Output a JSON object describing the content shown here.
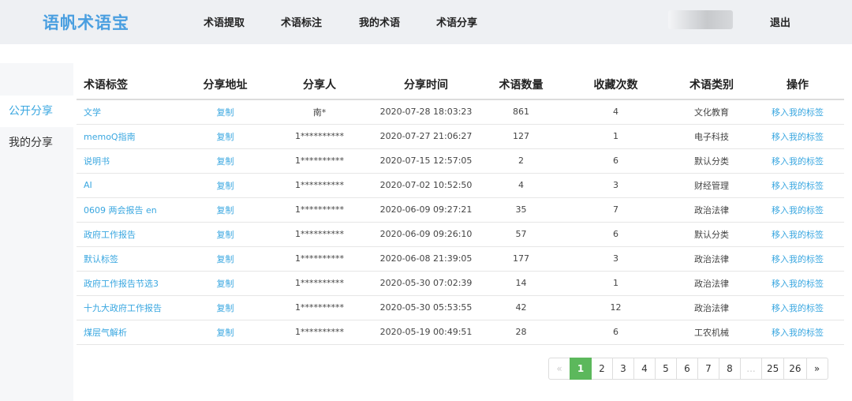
{
  "header": {
    "logo": "语帆术语宝",
    "nav": [
      "术语提取",
      "术语标注",
      "我的术语",
      "术语分享"
    ],
    "logout": "退出"
  },
  "sidebar": {
    "items": [
      {
        "label": "公开分享",
        "active": true
      },
      {
        "label": "我的分享",
        "active": false
      }
    ]
  },
  "table": {
    "headers": [
      "术语标签",
      "分享地址",
      "分享人",
      "分享时间",
      "术语数量",
      "收藏次数",
      "术语类别",
      "操作"
    ],
    "rows": [
      {
        "tag": "文学",
        "addr": "复制",
        "user": "南*",
        "time": "2020-07-28 18:03:23",
        "count": "861",
        "fav": "4",
        "cat": "文化教育",
        "op": "移入我的标签"
      },
      {
        "tag": "memoQ指南",
        "addr": "复制",
        "user": "1**********",
        "time": "2020-07-27 21:06:27",
        "count": "127",
        "fav": "1",
        "cat": "电子科技",
        "op": "移入我的标签"
      },
      {
        "tag": "说明书",
        "addr": "复制",
        "user": "1**********",
        "time": "2020-07-15 12:57:05",
        "count": "2",
        "fav": "6",
        "cat": "默认分类",
        "op": "移入我的标签"
      },
      {
        "tag": "AI",
        "addr": "复制",
        "user": "1**********",
        "time": "2020-07-02 10:52:50",
        "count": "4",
        "fav": "3",
        "cat": "财经管理",
        "op": "移入我的标签"
      },
      {
        "tag": "0609 两会报告 en",
        "addr": "复制",
        "user": "1**********",
        "time": "2020-06-09 09:27:21",
        "count": "35",
        "fav": "7",
        "cat": "政治法律",
        "op": "移入我的标签"
      },
      {
        "tag": "政府工作报告",
        "addr": "复制",
        "user": "1**********",
        "time": "2020-06-09 09:26:10",
        "count": "57",
        "fav": "6",
        "cat": "默认分类",
        "op": "移入我的标签"
      },
      {
        "tag": "默认标签",
        "addr": "复制",
        "user": "1**********",
        "time": "2020-06-08 21:39:05",
        "count": "177",
        "fav": "3",
        "cat": "政治法律",
        "op": "移入我的标签"
      },
      {
        "tag": "政府工作报告节选3",
        "addr": "复制",
        "user": "1**********",
        "time": "2020-05-30 07:02:39",
        "count": "14",
        "fav": "1",
        "cat": "政治法律",
        "op": "移入我的标签"
      },
      {
        "tag": "十九大政府工作报告",
        "addr": "复制",
        "user": "1**********",
        "time": "2020-05-30 05:53:55",
        "count": "42",
        "fav": "12",
        "cat": "政治法律",
        "op": "移入我的标签"
      },
      {
        "tag": "煤层气解析",
        "addr": "复制",
        "user": "1**********",
        "time": "2020-05-19 00:49:51",
        "count": "28",
        "fav": "6",
        "cat": "工农机械",
        "op": "移入我的标签"
      }
    ]
  },
  "pagination": {
    "prev": "«",
    "pages": [
      "1",
      "2",
      "3",
      "4",
      "5",
      "6",
      "7",
      "8",
      "...",
      "25",
      "26"
    ],
    "current": "1",
    "next": "»"
  },
  "colors": {
    "accent": "#3aa7e0",
    "logo": "#4a9fe0",
    "pager_active": "#5cb85c"
  }
}
